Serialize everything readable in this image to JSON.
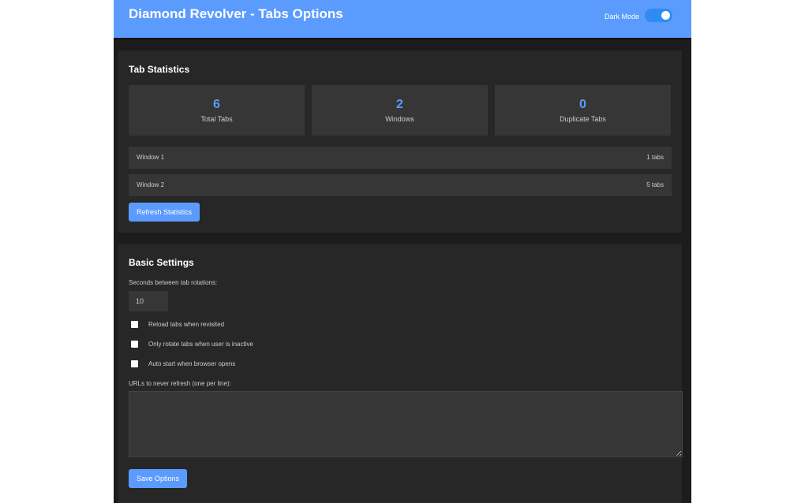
{
  "header": {
    "title": "Diamond Revolver - Tabs Options",
    "dark_mode_label": "Dark Mode",
    "dark_mode_on": true
  },
  "stats": {
    "heading": "Tab Statistics",
    "cards": [
      {
        "value": "6",
        "label": "Total Tabs"
      },
      {
        "value": "2",
        "label": "Windows"
      },
      {
        "value": "0",
        "label": "Duplicate Tabs"
      }
    ],
    "windows": [
      {
        "name": "Window 1",
        "count": "1 tabs"
      },
      {
        "name": "Window 2",
        "count": "5 tabs"
      }
    ],
    "refresh_label": "Refresh Statistics"
  },
  "settings": {
    "heading": "Basic Settings",
    "seconds_label": "Seconds between tab rotations:",
    "seconds_value": "10",
    "checkboxes": [
      {
        "label": "Reload tabs when revisited",
        "checked": false
      },
      {
        "label": "Only rotate tabs when user is inactive",
        "checked": false
      },
      {
        "label": "Auto start when browser opens",
        "checked": false
      }
    ],
    "urls_label": "URLs to never refresh (one per line):",
    "urls_value": "",
    "save_label": "Save Options"
  }
}
